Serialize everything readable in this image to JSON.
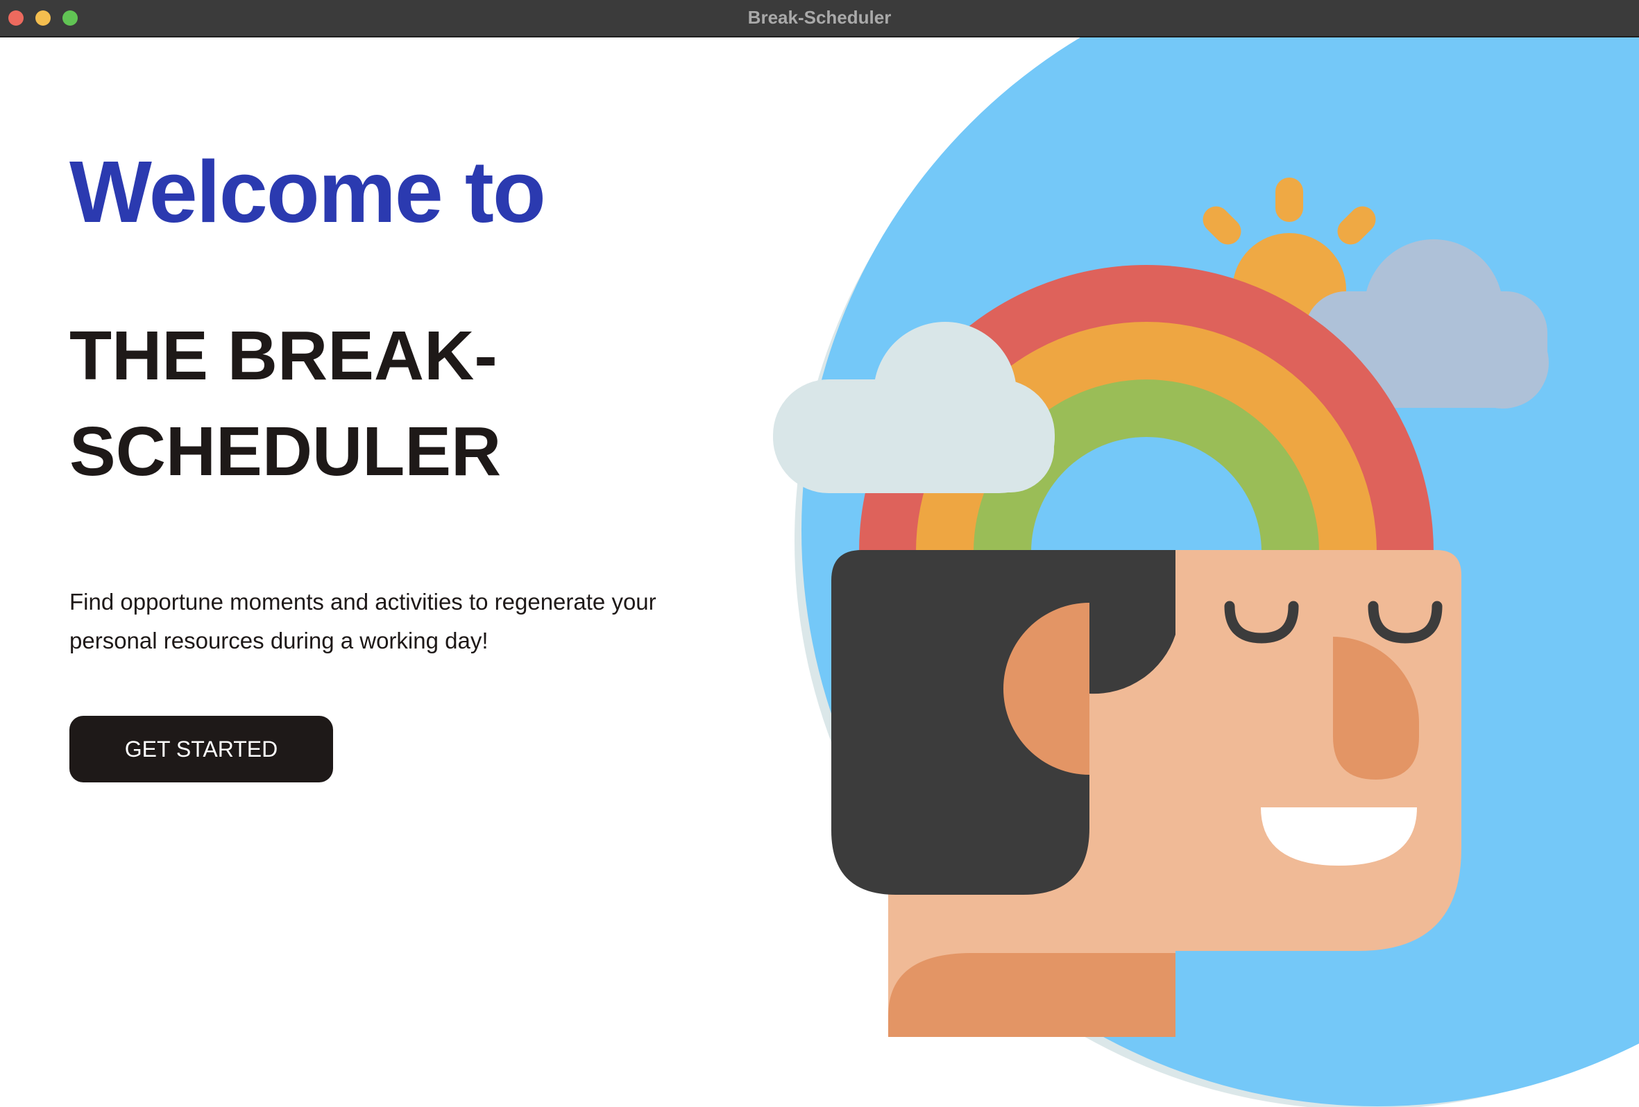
{
  "window": {
    "title": "Break-Scheduler"
  },
  "hero": {
    "welcome": "Welcome to",
    "app_name": "THE BREAK-SCHEDULER",
    "tagline": "Find opportune moments and activities to regenerate your personal resources during a working day!",
    "cta_label": "GET STARTED"
  },
  "colors": {
    "welcome_text": "#2b3ab0",
    "heading_text": "#1e1918",
    "button_bg": "#1e1918",
    "sky": "#74c8f8",
    "rainbow_red": "#de625b",
    "rainbow_orange": "#eea642",
    "rainbow_green": "#9abd57",
    "sun": "#efa944",
    "cloud_light": "#d9e6e8",
    "cloud_blue": "#aec1d8",
    "hair": "#3c3c3c",
    "skin": "#f0ba96",
    "skin_dark": "#e39565",
    "close_button": "#ed6a5e",
    "minimize_button": "#f4be4f",
    "zoom_button": "#61c454"
  },
  "icons": {
    "close": "close-icon",
    "minimize": "minimize-icon",
    "zoom": "zoom-icon",
    "illustration": "happy-head-rainbow-illustration"
  }
}
